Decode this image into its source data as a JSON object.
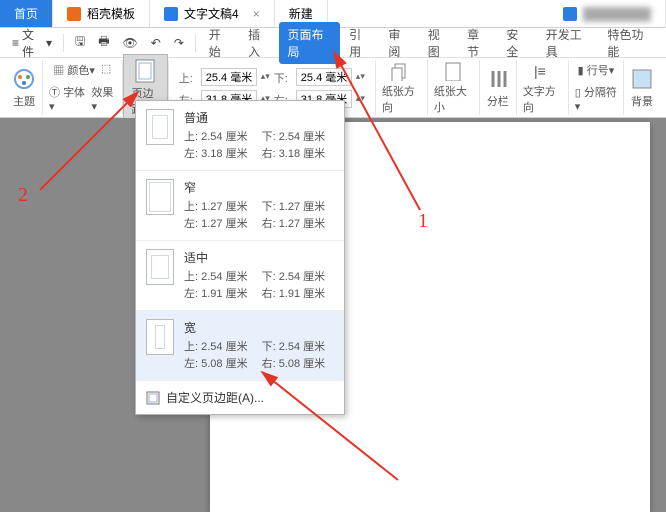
{
  "tabs": {
    "home": "首页",
    "templates": "稻壳模板",
    "doc": "文字文稿4",
    "new": "新建",
    "other": "████████"
  },
  "qat": {
    "file": "文件"
  },
  "menu": {
    "start": "开始",
    "insert": "插入",
    "layout": "页面布局",
    "ref": "引用",
    "review": "审阅",
    "view": "视图",
    "chapter": "章节",
    "safe": "安全",
    "dev": "开发工具",
    "feature": "特色功能"
  },
  "ribbon": {
    "theme": "主题",
    "font": "字体",
    "effect": "效果",
    "color": "颜色",
    "margins": "页边距",
    "top_lbl": "上:",
    "bottom_lbl": "下:",
    "left_lbl": "左:",
    "right_lbl": "右:",
    "top_val": "25.4 毫米",
    "bottom_val": "25.4 毫米",
    "left_val": "31.8 毫米",
    "right_val": "31.8 毫米",
    "orient": "纸张方向",
    "size": "纸张大小",
    "columns": "分栏",
    "textdir": "文字方向",
    "lineno": "行号",
    "breaks": "分隔符",
    "bg": "背景"
  },
  "presets": [
    {
      "name": "普通",
      "t": "上: 2.54 厘米",
      "b": "下: 2.54 厘米",
      "l": "左: 3.18 厘米",
      "r": "右: 3.18 厘米"
    },
    {
      "name": "窄",
      "t": "上: 1.27 厘米",
      "b": "下: 1.27 厘米",
      "l": "左: 1.27 厘米",
      "r": "右: 1.27 厘米"
    },
    {
      "name": "适中",
      "t": "上: 2.54 厘米",
      "b": "下: 2.54 厘米",
      "l": "左: 1.91 厘米",
      "r": "右: 1.91 厘米"
    },
    {
      "name": "宽",
      "t": "上: 2.54 厘米",
      "b": "下: 2.54 厘米",
      "l": "左: 5.08 厘米",
      "r": "右: 5.08 厘米"
    }
  ],
  "custom": "自定义页边距(A)...",
  "annot": {
    "one": "1",
    "two": "2"
  }
}
